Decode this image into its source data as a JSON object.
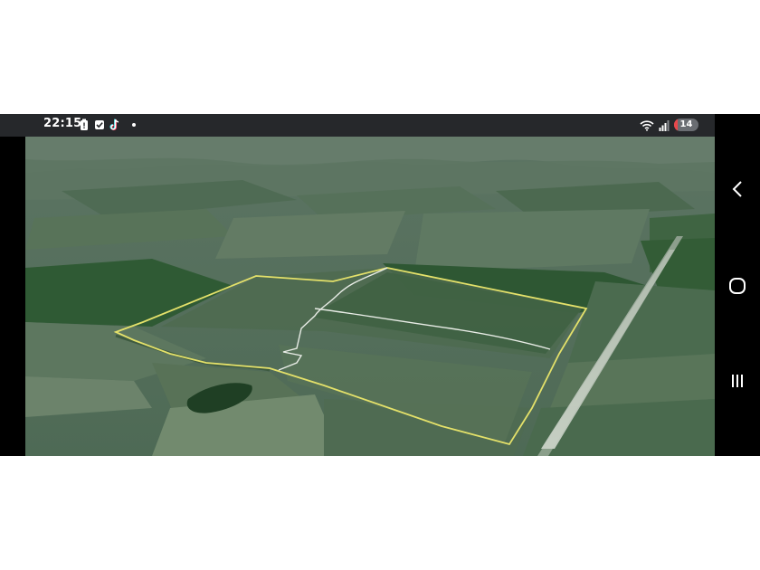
{
  "status_bar": {
    "time": "22:15",
    "left_icons": [
      "battery-saver-icon",
      "checkbox-icon",
      "tiktok-icon",
      "notification-dot-icon"
    ],
    "right_icons": [
      "wifi-icon",
      "signal-icon"
    ],
    "battery_level": "14",
    "battery_fraction": 0.14,
    "battery_color": "#e8474b"
  },
  "map": {
    "view": "3d-satellite",
    "boundary_color": "#e4e16a",
    "inner_line_color": "#e8ece6"
  },
  "nav_bar": {
    "buttons": [
      "back-icon",
      "home-icon",
      "recents-icon"
    ]
  }
}
